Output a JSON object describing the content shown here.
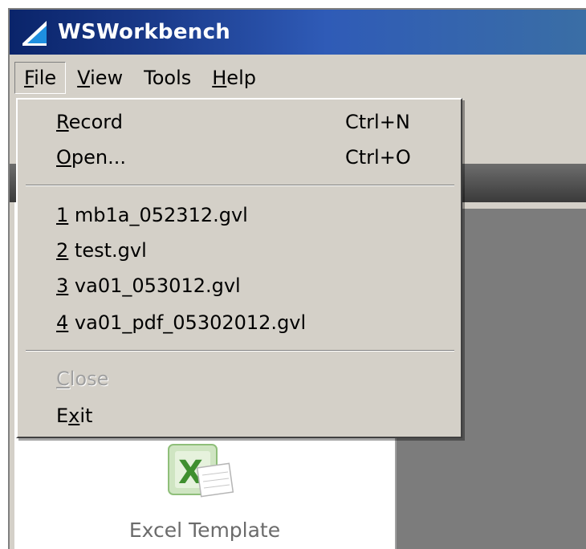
{
  "window": {
    "title": "WSWorkbench"
  },
  "menubar": {
    "file_hotkey": "F",
    "file_rest": "ile",
    "view_hotkey": "V",
    "view_rest": "iew",
    "tools_label": "Tools",
    "help_hotkey": "H",
    "help_rest": "elp"
  },
  "file_menu": {
    "record": {
      "hotkey": "R",
      "rest": "ecord",
      "shortcut": "Ctrl+N"
    },
    "open": {
      "hotkey": "O",
      "rest": "pen...",
      "shortcut": "Ctrl+O"
    },
    "recent": [
      {
        "num": "1",
        "name": " mb1a_052312.gvl"
      },
      {
        "num": "2",
        "name": " test.gvl"
      },
      {
        "num": "3",
        "name": " va01_053012.gvl"
      },
      {
        "num": "4",
        "name": " va01_pdf_05302012.gvl"
      }
    ],
    "close": {
      "hotkey": "C",
      "rest": "lose",
      "enabled": false
    },
    "exit": {
      "pre": "E",
      "hotkey": "x",
      "rest": "it"
    }
  },
  "panel": {
    "excel_template_label": "Excel Template"
  },
  "icons": {
    "app": "wsworkbench-logo-icon",
    "excel": "excel-icon"
  },
  "colors": {
    "titlebar_start": "#0a246a",
    "titlebar_end": "#3a6ea5",
    "menu_bg": "#d4d0c8"
  }
}
